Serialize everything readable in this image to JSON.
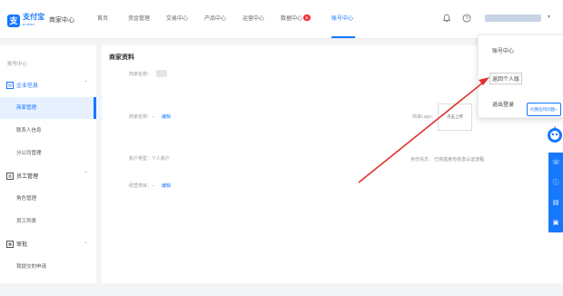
{
  "header": {
    "logo_text": "支付宝",
    "logo_sub": "ALIPAY",
    "merchant_center": "商家中心",
    "nav": [
      {
        "label": "首页"
      },
      {
        "label": "资金管理"
      },
      {
        "label": "交易中心"
      },
      {
        "label": "产品中心"
      },
      {
        "label": "运营中心"
      },
      {
        "label": "数据中心",
        "badge": "新"
      },
      {
        "label": "账号中心",
        "active": true
      }
    ],
    "bell_icon": "bell-icon",
    "help_icon": "question-icon",
    "user_caret": "▾"
  },
  "sidebar": {
    "title": "账号中心",
    "groups": [
      {
        "label": "企业信息",
        "active": true,
        "items": [
          {
            "label": "商家管理",
            "active": true
          },
          {
            "label": "联系人信息"
          },
          {
            "label": "分公司管理"
          }
        ]
      },
      {
        "label": "员工管理",
        "items": [
          {
            "label": "角色管理"
          },
          {
            "label": "员工列表"
          }
        ]
      },
      {
        "label": "审批",
        "items": [
          {
            "label": "我提交的申请"
          }
        ]
      }
    ]
  },
  "content": {
    "title": "商家资料",
    "rows": [
      {
        "label": "商家名称："
      },
      {
        "label": "商家名称：--",
        "action": "编辑"
      },
      {
        "label": "账户类型：个人账户"
      },
      {
        "label": "经营类目：--",
        "action": "编辑"
      }
    ],
    "right_label_1": "商家Logo：",
    "right_box": "点击上传",
    "right_label_2": "身份信息：",
    "right_value_2": "已完成身份信息认证流程"
  },
  "dropdown": {
    "items": [
      "账号中心",
      "返回个人版",
      "退出登录"
    ]
  },
  "helper": {
    "tip": "问我任何问题~",
    "icons": [
      "chat-icon",
      "info-icon",
      "document-icon",
      "feedback-icon"
    ]
  },
  "colors": {
    "accent": "#1677ff",
    "arrow": "#e0312b"
  }
}
